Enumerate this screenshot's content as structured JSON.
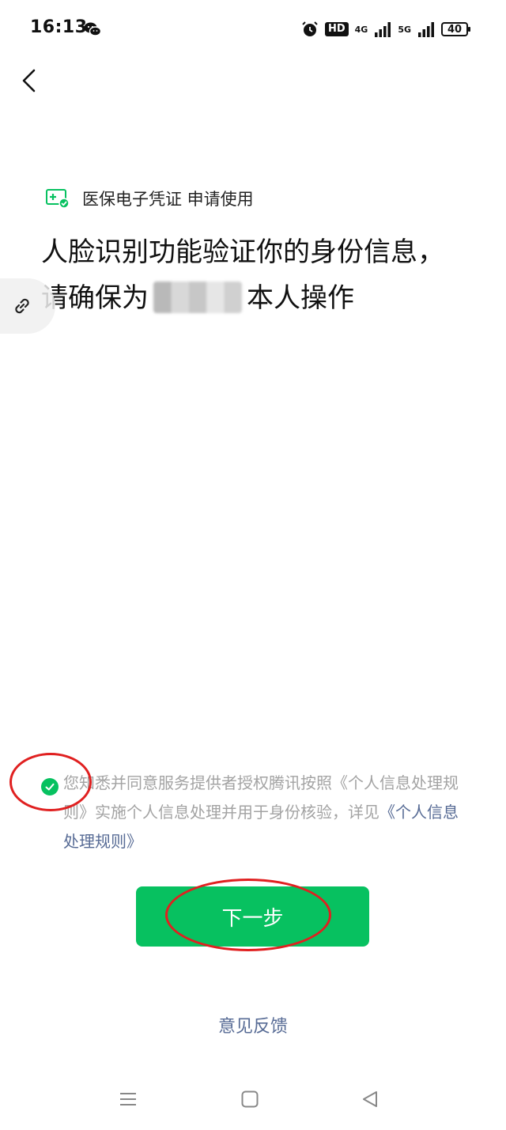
{
  "status_bar": {
    "time": "16:13",
    "hd": "HD",
    "network_1": "4G",
    "network_2": "5G",
    "battery": "40"
  },
  "service": {
    "name": "医保电子凭证 申请使用"
  },
  "headline": {
    "line1": "人脸识别功能验证你的身份信息，",
    "line2_prefix": "请确保为",
    "line2_suffix": "本人操作"
  },
  "consent": {
    "text": "您知悉并同意服务提供者授权腾讯按照《个人信息处理规则》实施个人信息处理并用于身份核验，详见",
    "link": "《个人信息处理规则》"
  },
  "actions": {
    "next_label": "下一步",
    "feedback_label": "意见反馈"
  },
  "colors": {
    "accent": "#07c160",
    "link": "#576b95",
    "annotation": "#e02020"
  }
}
